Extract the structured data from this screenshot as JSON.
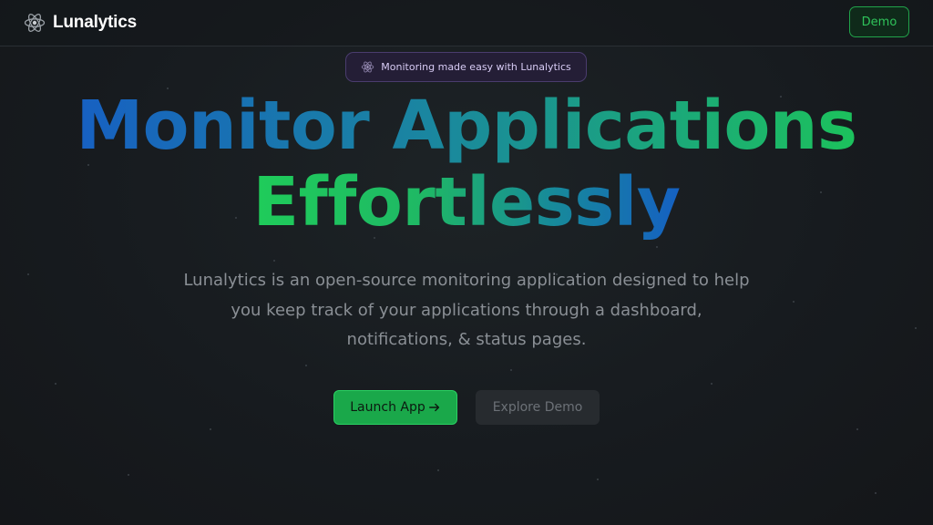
{
  "header": {
    "brand_name": "Lunalytics",
    "brand_icon": "atom-icon",
    "demo_label": "Demo"
  },
  "badge": {
    "text": "Monitoring made easy with Lunalytics",
    "icon": "atom-icon"
  },
  "hero": {
    "heading_line1": "Monitor Applications",
    "heading_line2": "Effortlessly",
    "description": "Lunalytics is an open-source monitoring application designed to help you keep track of your applications through a dashboard, notifications, & status pages."
  },
  "cta": {
    "launch_label": "Launch App",
    "launch_icon": "arrow-right-icon",
    "explore_label": "Explore Demo"
  },
  "colors": {
    "background": "#16191d",
    "accent_green": "#1aa84a",
    "accent_blue": "#1760c2",
    "badge_purple": "#241e36"
  }
}
